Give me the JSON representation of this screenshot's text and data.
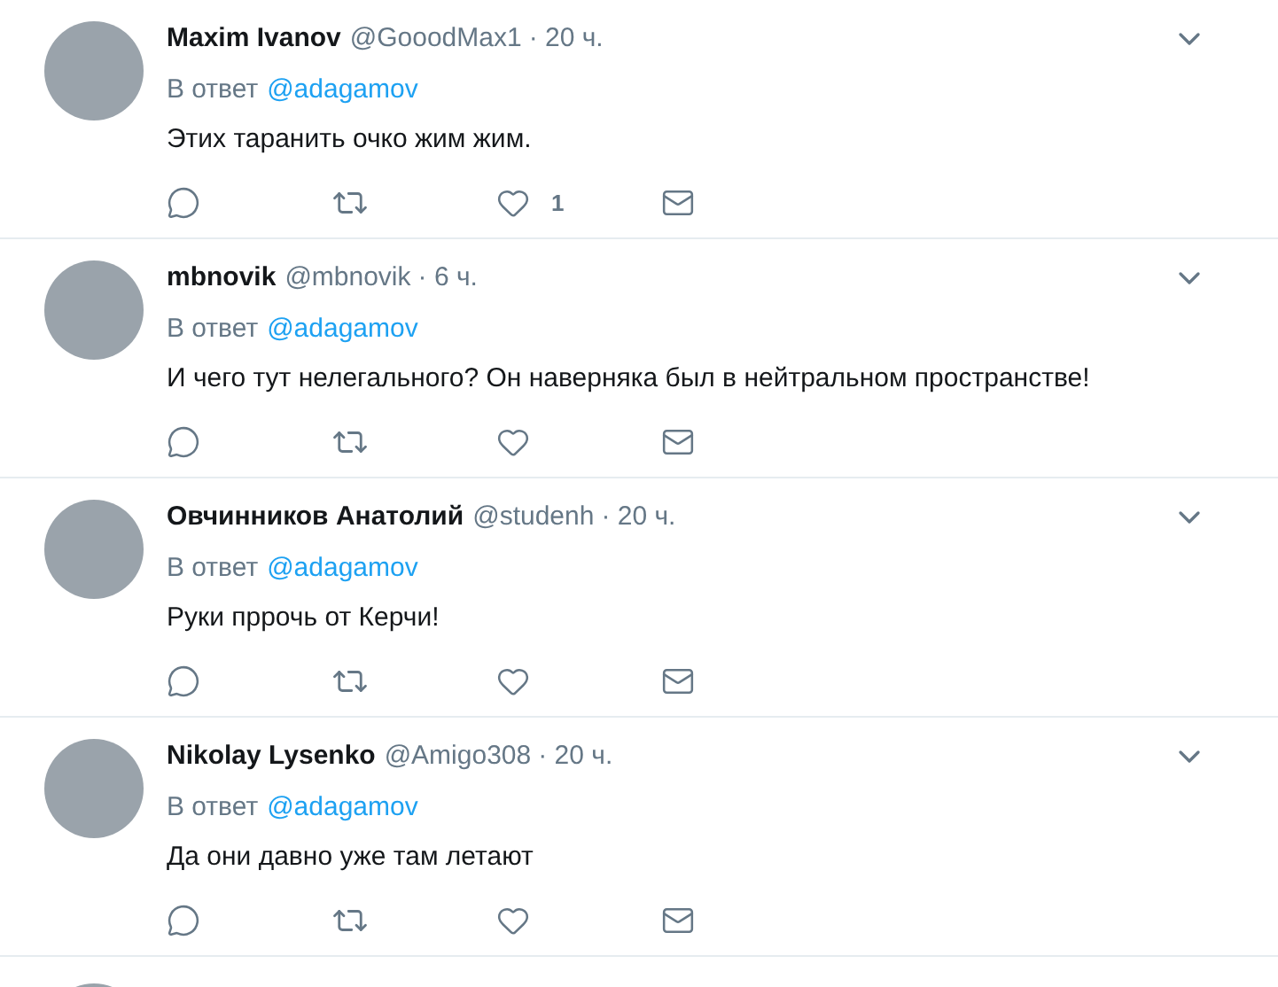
{
  "tweets": [
    {
      "name": "Maxim Ivanov",
      "handle": "@GooodMax1",
      "time": "· 20 ч.",
      "reply_prefix": "В ответ",
      "reply_to": "@adagamov",
      "text": "Этих таранить очко жим жим.",
      "likes": "1"
    },
    {
      "name": "mbnovik",
      "handle": "@mbnovik",
      "time": "· 6 ч.",
      "reply_prefix": "В ответ",
      "reply_to": "@adagamov",
      "text": "И чего тут нелегального?  Он наверняка был в нейтральном пространстве!"
    },
    {
      "name": "Овчинников Анатолий",
      "handle": "@studenh",
      "time": "· 20 ч.",
      "reply_prefix": "В ответ",
      "reply_to": "@adagamov",
      "text": "Руки пррочь от Керчи!"
    },
    {
      "name": "Nikolay Lysenko",
      "handle": "@Amigo308",
      "time": "· 20 ч.",
      "reply_prefix": "В ответ",
      "reply_to": "@adagamov",
      "text": "Да они давно уже там летают"
    }
  ]
}
